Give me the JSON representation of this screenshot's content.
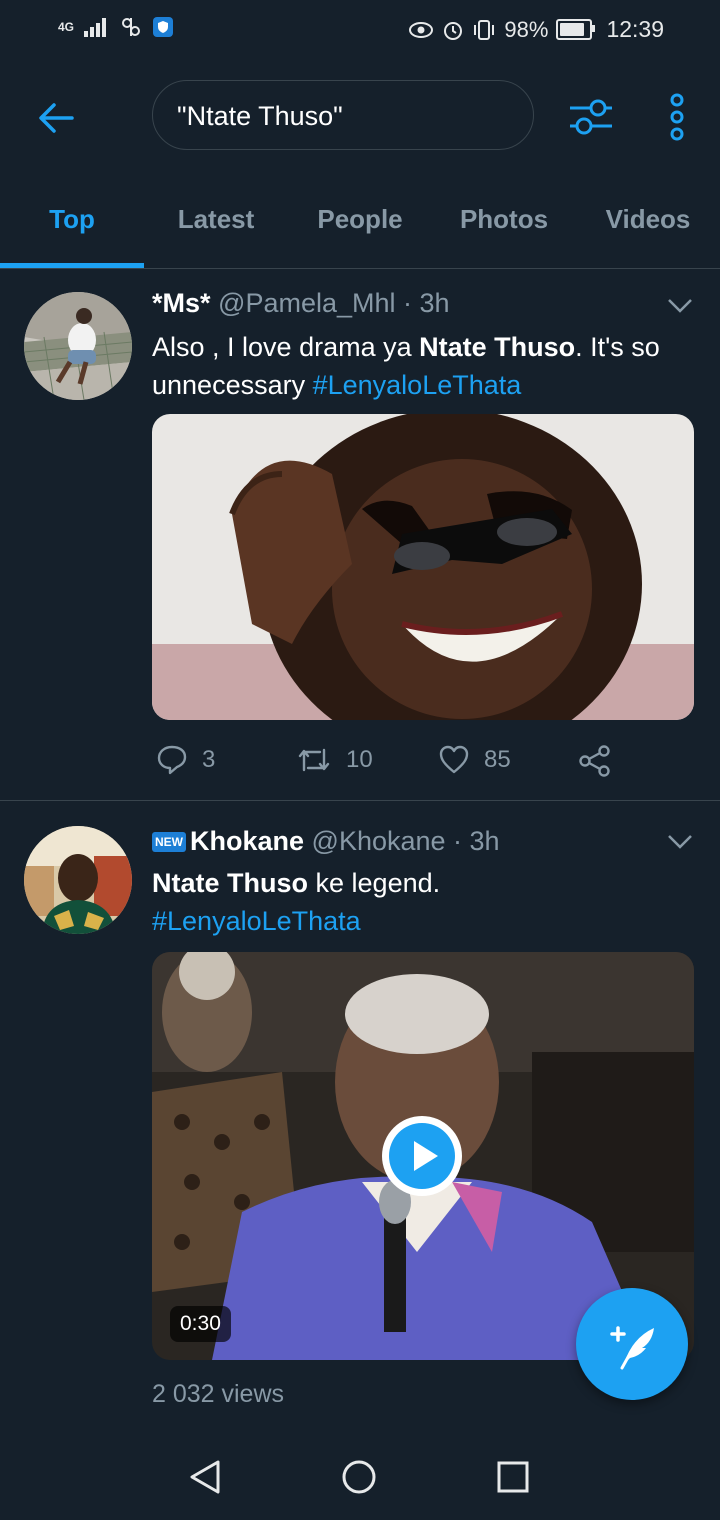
{
  "status_bar": {
    "network": "4G",
    "battery": "98%",
    "time": "12:39"
  },
  "search": {
    "query": "\"Ntate Thuso\""
  },
  "tabs": [
    {
      "label": "Top",
      "active": true
    },
    {
      "label": "Latest",
      "active": false
    },
    {
      "label": "People",
      "active": false
    },
    {
      "label": "Photos",
      "active": false
    },
    {
      "label": "Videos",
      "active": false
    }
  ],
  "tweets": [
    {
      "name": "*Ms*",
      "meta": "@Pamela_Mhl · 3h",
      "text_before": "Also , I love drama ya ",
      "text_bold": "Ntate Thuso",
      "text_after": ". It's so unnecessary ",
      "hashtag": "#LenyaloLeThata",
      "replies": "3",
      "retweets": "10",
      "likes": "85"
    },
    {
      "badge": "NEW",
      "name": "Khokane",
      "meta": "@Khokane · 3h",
      "text_bold": "Ntate Thuso",
      "text_after": " ke legend.",
      "hashtag": "#LenyaloLeThata",
      "duration": "0:30",
      "views": "2 032 views"
    }
  ],
  "colors": {
    "background": "#15202b",
    "accent": "#1da1f2",
    "muted": "#8899a6",
    "divider": "#38444d"
  }
}
